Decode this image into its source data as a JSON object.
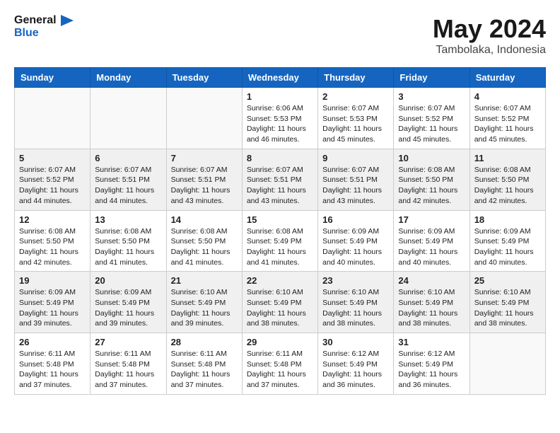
{
  "logo": {
    "line1": "General",
    "line2": "Blue"
  },
  "title": "May 2024",
  "location": "Tambolaka, Indonesia",
  "weekdays": [
    "Sunday",
    "Monday",
    "Tuesday",
    "Wednesday",
    "Thursday",
    "Friday",
    "Saturday"
  ],
  "weeks": [
    [
      {
        "day": "",
        "sunrise": "",
        "sunset": "",
        "daylight": ""
      },
      {
        "day": "",
        "sunrise": "",
        "sunset": "",
        "daylight": ""
      },
      {
        "day": "",
        "sunrise": "",
        "sunset": "",
        "daylight": ""
      },
      {
        "day": "1",
        "sunrise": "Sunrise: 6:06 AM",
        "sunset": "Sunset: 5:53 PM",
        "daylight": "Daylight: 11 hours and 46 minutes."
      },
      {
        "day": "2",
        "sunrise": "Sunrise: 6:07 AM",
        "sunset": "Sunset: 5:53 PM",
        "daylight": "Daylight: 11 hours and 45 minutes."
      },
      {
        "day": "3",
        "sunrise": "Sunrise: 6:07 AM",
        "sunset": "Sunset: 5:52 PM",
        "daylight": "Daylight: 11 hours and 45 minutes."
      },
      {
        "day": "4",
        "sunrise": "Sunrise: 6:07 AM",
        "sunset": "Sunset: 5:52 PM",
        "daylight": "Daylight: 11 hours and 45 minutes."
      }
    ],
    [
      {
        "day": "5",
        "sunrise": "Sunrise: 6:07 AM",
        "sunset": "Sunset: 5:52 PM",
        "daylight": "Daylight: 11 hours and 44 minutes."
      },
      {
        "day": "6",
        "sunrise": "Sunrise: 6:07 AM",
        "sunset": "Sunset: 5:51 PM",
        "daylight": "Daylight: 11 hours and 44 minutes."
      },
      {
        "day": "7",
        "sunrise": "Sunrise: 6:07 AM",
        "sunset": "Sunset: 5:51 PM",
        "daylight": "Daylight: 11 hours and 43 minutes."
      },
      {
        "day": "8",
        "sunrise": "Sunrise: 6:07 AM",
        "sunset": "Sunset: 5:51 PM",
        "daylight": "Daylight: 11 hours and 43 minutes."
      },
      {
        "day": "9",
        "sunrise": "Sunrise: 6:07 AM",
        "sunset": "Sunset: 5:51 PM",
        "daylight": "Daylight: 11 hours and 43 minutes."
      },
      {
        "day": "10",
        "sunrise": "Sunrise: 6:08 AM",
        "sunset": "Sunset: 5:50 PM",
        "daylight": "Daylight: 11 hours and 42 minutes."
      },
      {
        "day": "11",
        "sunrise": "Sunrise: 6:08 AM",
        "sunset": "Sunset: 5:50 PM",
        "daylight": "Daylight: 11 hours and 42 minutes."
      }
    ],
    [
      {
        "day": "12",
        "sunrise": "Sunrise: 6:08 AM",
        "sunset": "Sunset: 5:50 PM",
        "daylight": "Daylight: 11 hours and 42 minutes."
      },
      {
        "day": "13",
        "sunrise": "Sunrise: 6:08 AM",
        "sunset": "Sunset: 5:50 PM",
        "daylight": "Daylight: 11 hours and 41 minutes."
      },
      {
        "day": "14",
        "sunrise": "Sunrise: 6:08 AM",
        "sunset": "Sunset: 5:50 PM",
        "daylight": "Daylight: 11 hours and 41 minutes."
      },
      {
        "day": "15",
        "sunrise": "Sunrise: 6:08 AM",
        "sunset": "Sunset: 5:49 PM",
        "daylight": "Daylight: 11 hours and 41 minutes."
      },
      {
        "day": "16",
        "sunrise": "Sunrise: 6:09 AM",
        "sunset": "Sunset: 5:49 PM",
        "daylight": "Daylight: 11 hours and 40 minutes."
      },
      {
        "day": "17",
        "sunrise": "Sunrise: 6:09 AM",
        "sunset": "Sunset: 5:49 PM",
        "daylight": "Daylight: 11 hours and 40 minutes."
      },
      {
        "day": "18",
        "sunrise": "Sunrise: 6:09 AM",
        "sunset": "Sunset: 5:49 PM",
        "daylight": "Daylight: 11 hours and 40 minutes."
      }
    ],
    [
      {
        "day": "19",
        "sunrise": "Sunrise: 6:09 AM",
        "sunset": "Sunset: 5:49 PM",
        "daylight": "Daylight: 11 hours and 39 minutes."
      },
      {
        "day": "20",
        "sunrise": "Sunrise: 6:09 AM",
        "sunset": "Sunset: 5:49 PM",
        "daylight": "Daylight: 11 hours and 39 minutes."
      },
      {
        "day": "21",
        "sunrise": "Sunrise: 6:10 AM",
        "sunset": "Sunset: 5:49 PM",
        "daylight": "Daylight: 11 hours and 39 minutes."
      },
      {
        "day": "22",
        "sunrise": "Sunrise: 6:10 AM",
        "sunset": "Sunset: 5:49 PM",
        "daylight": "Daylight: 11 hours and 38 minutes."
      },
      {
        "day": "23",
        "sunrise": "Sunrise: 6:10 AM",
        "sunset": "Sunset: 5:49 PM",
        "daylight": "Daylight: 11 hours and 38 minutes."
      },
      {
        "day": "24",
        "sunrise": "Sunrise: 6:10 AM",
        "sunset": "Sunset: 5:49 PM",
        "daylight": "Daylight: 11 hours and 38 minutes."
      },
      {
        "day": "25",
        "sunrise": "Sunrise: 6:10 AM",
        "sunset": "Sunset: 5:49 PM",
        "daylight": "Daylight: 11 hours and 38 minutes."
      }
    ],
    [
      {
        "day": "26",
        "sunrise": "Sunrise: 6:11 AM",
        "sunset": "Sunset: 5:48 PM",
        "daylight": "Daylight: 11 hours and 37 minutes."
      },
      {
        "day": "27",
        "sunrise": "Sunrise: 6:11 AM",
        "sunset": "Sunset: 5:48 PM",
        "daylight": "Daylight: 11 hours and 37 minutes."
      },
      {
        "day": "28",
        "sunrise": "Sunrise: 6:11 AM",
        "sunset": "Sunset: 5:48 PM",
        "daylight": "Daylight: 11 hours and 37 minutes."
      },
      {
        "day": "29",
        "sunrise": "Sunrise: 6:11 AM",
        "sunset": "Sunset: 5:48 PM",
        "daylight": "Daylight: 11 hours and 37 minutes."
      },
      {
        "day": "30",
        "sunrise": "Sunrise: 6:12 AM",
        "sunset": "Sunset: 5:49 PM",
        "daylight": "Daylight: 11 hours and 36 minutes."
      },
      {
        "day": "31",
        "sunrise": "Sunrise: 6:12 AM",
        "sunset": "Sunset: 5:49 PM",
        "daylight": "Daylight: 11 hours and 36 minutes."
      },
      {
        "day": "",
        "sunrise": "",
        "sunset": "",
        "daylight": ""
      }
    ]
  ]
}
